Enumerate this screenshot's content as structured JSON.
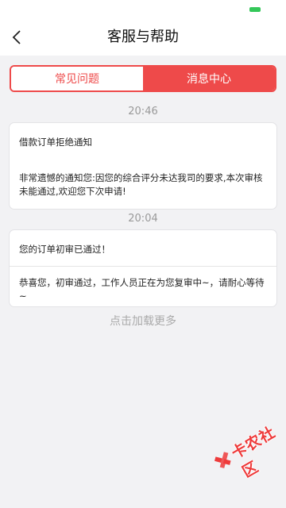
{
  "status_bar": {
    "battery_color": "#34c759"
  },
  "header": {
    "title": "客服与帮助",
    "back_icon": "chevron-left-icon"
  },
  "tabs": [
    {
      "label": "常见问题",
      "active": false
    },
    {
      "label": "消息中心",
      "active": true
    }
  ],
  "messages": [
    {
      "time": "20:46",
      "title": "借款订单拒绝通知",
      "body": "非常遗憾的通知您:因您的综合评分未达我司的要求,本次审核未能通过,欢迎您下次申请!"
    },
    {
      "time": "20:04",
      "title": "您的订单初审已通过！",
      "body": "恭喜您，初审通过，工作人员正在为您复审中~，请耐心等待~"
    }
  ],
  "load_more": "点击加载更多",
  "watermark": {
    "text": "卡农社区",
    "icon": "kanong-logo-icon"
  },
  "colors": {
    "accent": "#ee4a4a",
    "background": "#f2f2f4"
  }
}
